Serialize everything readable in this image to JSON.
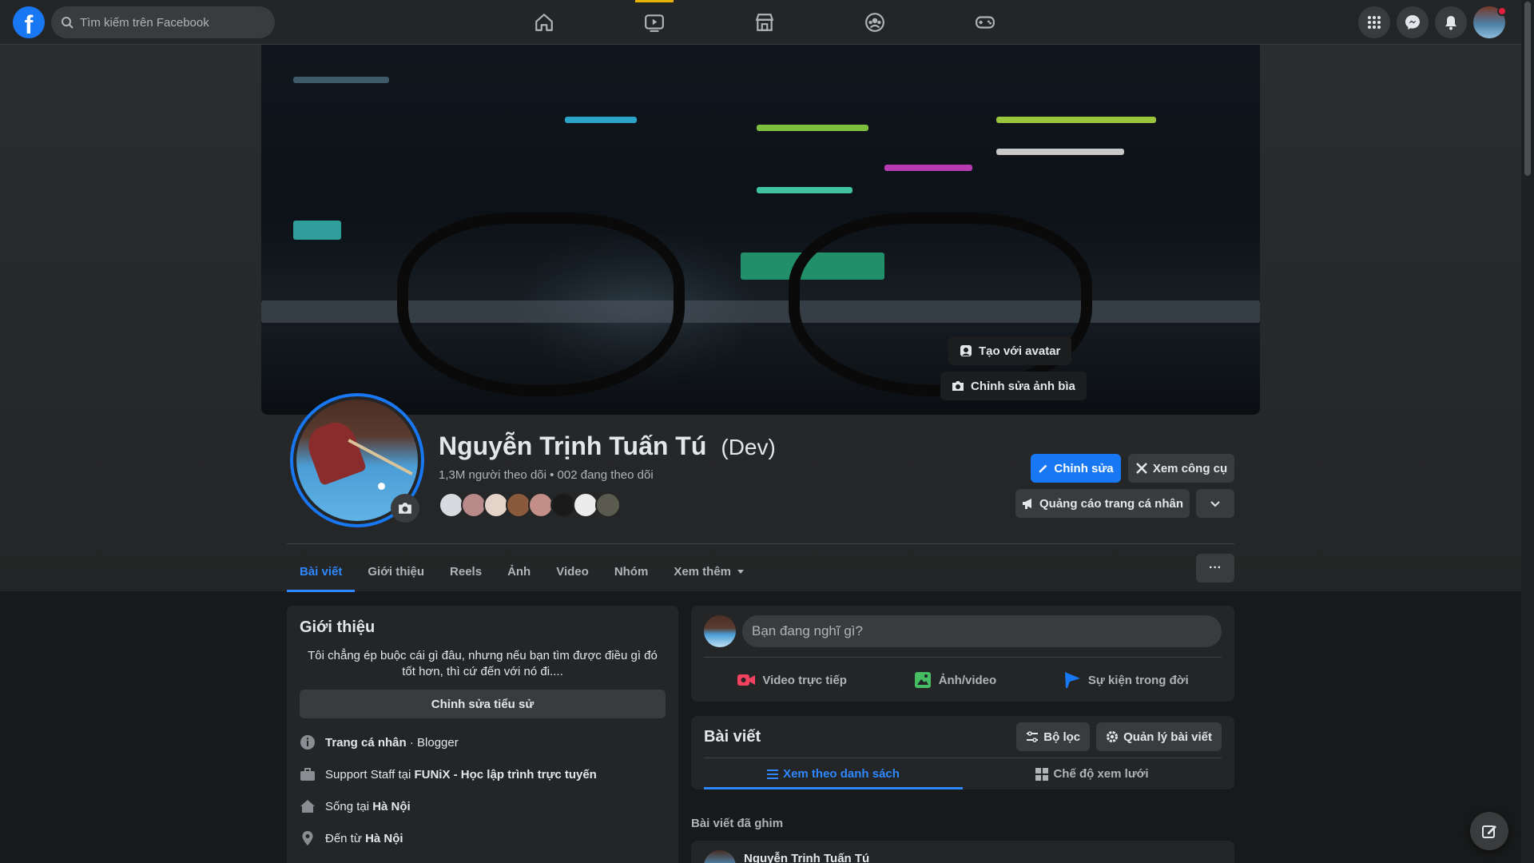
{
  "topbar": {
    "logo": "f",
    "search_placeholder": "Tìm kiếm trên Facebook",
    "nav": [
      {
        "name": "home-icon",
        "active": false
      },
      {
        "name": "watch-icon",
        "active": true
      },
      {
        "name": "marketplace-icon",
        "active": false
      },
      {
        "name": "groups-icon",
        "active": false
      },
      {
        "name": "gaming-icon",
        "active": false
      }
    ],
    "right_icons": [
      "menu-grid-icon",
      "messenger-icon",
      "bell-icon",
      "account-avatar"
    ]
  },
  "cover": {
    "create_avatar_label": "Tạo với avatar",
    "edit_cover_label": "Chỉnh sửa ảnh bìa"
  },
  "profile": {
    "name": "Nguyễn Trịnh Tuấn Tú",
    "nickname": "(Dev)",
    "followers_text": "1,3M người theo dõi • 002 đang theo dõi",
    "edit_label": "Chỉnh sửa",
    "tools_label": "Xem công cụ",
    "ads_label": "Quảng cáo trang cá nhân"
  },
  "tabs": [
    {
      "label": "Bài viết",
      "active": true
    },
    {
      "label": "Giới thiệu",
      "active": false
    },
    {
      "label": "Reels",
      "active": false
    },
    {
      "label": "Ảnh",
      "active": false
    },
    {
      "label": "Video",
      "active": false
    },
    {
      "label": "Nhóm",
      "active": false
    },
    {
      "label": "Xem thêm",
      "active": false
    }
  ],
  "more_label": "···",
  "intro": {
    "title": "Giới thiệu",
    "bio": "Tôi chẳng ép buộc cái gì đâu, nhưng nếu bạn tìm được điều gì đó tốt hơn, thì cứ đến với nó đi....",
    "edit_bio_label": "Chỉnh sửa tiểu sử",
    "items": [
      {
        "icon": "info-icon",
        "prefix": "Trang cá nhân",
        "bold": "",
        "suffix": " · Blogger"
      },
      {
        "icon": "briefcase-icon",
        "prefix": "Support Staff tại ",
        "bold": "FUNiX - Học lập trình trực tuyến",
        "suffix": ""
      },
      {
        "icon": "home-icon",
        "prefix": "Sống tại ",
        "bold": "Hà Nội",
        "suffix": ""
      },
      {
        "icon": "location-pin-icon",
        "prefix": "Đến từ ",
        "bold": "Hà Nội",
        "suffix": ""
      }
    ]
  },
  "composer": {
    "placeholder": "Bạn đang nghĩ gì?",
    "live_label": "Video trực tiếp",
    "photo_label": "Ảnh/video",
    "event_label": "Sự kiện trong đời",
    "colors": {
      "live": "#f3425f",
      "photo": "#45bd62",
      "event": "#1877f2"
    }
  },
  "posts": {
    "title": "Bài viết",
    "filter_label": "Bộ lọc",
    "manage_label": "Quản lý bài viết",
    "list_view_label": "Xem theo danh sách",
    "grid_view_label": "Chế độ xem lưới"
  },
  "pinned": {
    "label": "Bài viết đã ghim",
    "author": "Nguyễn Trịnh Tuấn Tú"
  }
}
